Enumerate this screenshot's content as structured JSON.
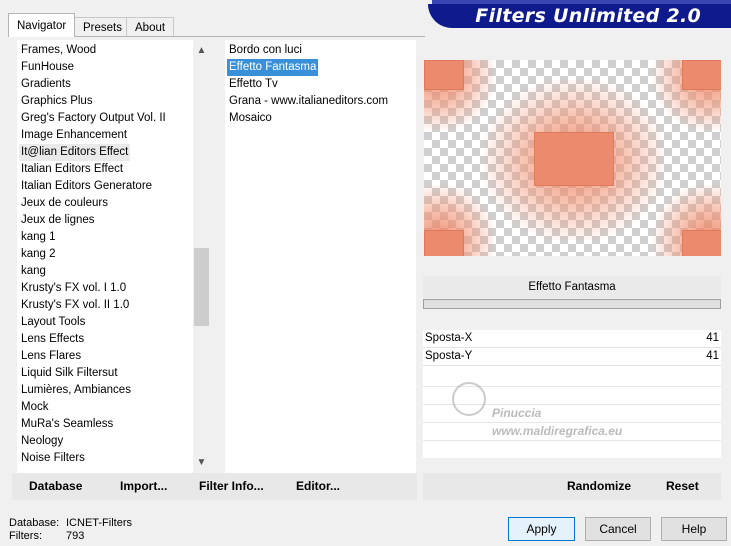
{
  "tabs": [
    {
      "label": "Navigator",
      "active": true
    },
    {
      "label": "Presets",
      "active": false
    },
    {
      "label": "About",
      "active": false
    }
  ],
  "banner": {
    "title": "Filters Unlimited 2.0"
  },
  "categories": [
    "Frames, Wood",
    "FunHouse",
    "Gradients",
    "Graphics Plus",
    "Greg's Factory Output Vol. II",
    "Image Enhancement",
    "It@lian Editors Effect",
    "Italian Editors Effect",
    "Italian Editors Generatore",
    "Jeux de couleurs",
    "Jeux de lignes",
    "kang 1",
    "kang 2",
    "kang",
    "Krusty's FX vol. I 1.0",
    "Krusty's FX vol. II 1.0",
    "Layout Tools",
    "Lens Effects",
    "Lens Flares",
    "Liquid Silk Filtersut",
    "Lumières, Ambiances",
    "Mock",
    "MuRa's Seamless",
    "Neology",
    "Noise Filters"
  ],
  "selected_category": "It@lian Editors Effect",
  "filters": [
    "Bordo con luci",
    "Effetto Fantasma",
    "Effetto Tv",
    "Grana - www.italianeditors.com",
    "Mosaico"
  ],
  "selected_filter": "Effetto Fantasma",
  "filter_panel": {
    "title": "Effetto Fantasma",
    "params": [
      {
        "name": "Sposta-X",
        "value": "41"
      },
      {
        "name": "Sposta-Y",
        "value": "41"
      }
    ]
  },
  "watermark": {
    "line1": "Pinuccia",
    "line2": "www.maldiregrafica.eu"
  },
  "left_toolbar": {
    "database": "Database",
    "import": "Import...",
    "filter_info": "Filter Info...",
    "editor": "Editor..."
  },
  "right_toolbar": {
    "randomize": "Randomize",
    "reset": "Reset"
  },
  "status": {
    "database_label": "Database:",
    "database_value": "ICNET-Filters",
    "filters_label": "Filters:",
    "filters_value": "793"
  },
  "buttons": {
    "apply": "Apply",
    "cancel": "Cancel",
    "help": "Help"
  },
  "colors": {
    "banner": "#0f1a8c",
    "selection": "#3a8fd9",
    "preview_tone": "#ec8a6e"
  }
}
